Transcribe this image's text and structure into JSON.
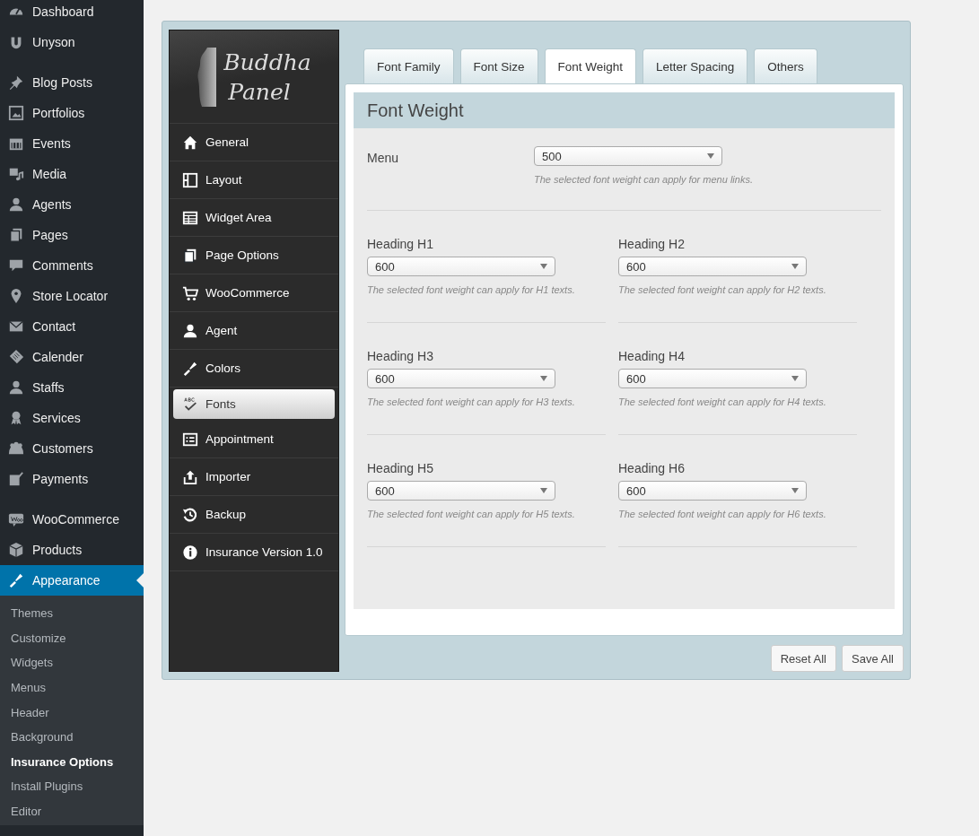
{
  "admin_menu": {
    "groups": [
      [
        {
          "label": "Dashboard",
          "selected": false
        },
        {
          "label": "Unyson",
          "selected": false
        }
      ],
      [
        {
          "label": "Blog Posts",
          "selected": false
        },
        {
          "label": "Portfolios",
          "selected": false
        },
        {
          "label": "Events",
          "selected": false
        },
        {
          "label": "Media",
          "selected": false
        },
        {
          "label": "Agents",
          "selected": false
        },
        {
          "label": "Pages",
          "selected": false
        },
        {
          "label": "Comments",
          "selected": false
        },
        {
          "label": "Store Locator",
          "selected": false
        },
        {
          "label": "Contact",
          "selected": false
        },
        {
          "label": "Calender",
          "selected": false
        },
        {
          "label": "Staffs",
          "selected": false
        },
        {
          "label": "Services",
          "selected": false
        },
        {
          "label": "Customers",
          "selected": false
        },
        {
          "label": "Payments",
          "selected": false
        }
      ],
      [
        {
          "label": "WooCommerce",
          "selected": false
        },
        {
          "label": "Products",
          "selected": false
        },
        {
          "label": "Appearance",
          "selected": true
        }
      ]
    ],
    "submenu": [
      {
        "label": "Themes",
        "selected": false
      },
      {
        "label": "Customize",
        "selected": false
      },
      {
        "label": "Widgets",
        "selected": false
      },
      {
        "label": "Menus",
        "selected": false
      },
      {
        "label": "Header",
        "selected": false
      },
      {
        "label": "Background",
        "selected": false
      },
      {
        "label": "Insurance Options",
        "selected": true
      },
      {
        "label": "Install Plugins",
        "selected": false
      },
      {
        "label": "Editor",
        "selected": false
      }
    ]
  },
  "panel": {
    "logo": {
      "line_1": "Buddha",
      "line_2": "Panel"
    },
    "nav": [
      {
        "label": "General",
        "selected": false
      },
      {
        "label": "Layout",
        "selected": false
      },
      {
        "label": "Widget Area",
        "selected": false
      },
      {
        "label": "Page Options",
        "selected": false
      },
      {
        "label": "WooCommerce",
        "selected": false
      },
      {
        "label": "Agent",
        "selected": false
      },
      {
        "label": "Colors",
        "selected": false
      },
      {
        "label": "Fonts",
        "selected": true
      },
      {
        "label": "Appointment",
        "selected": false
      },
      {
        "label": "Importer",
        "selected": false
      },
      {
        "label": "Backup",
        "selected": false
      },
      {
        "label": "Insurance Version 1.0",
        "selected": false
      }
    ],
    "tabs": [
      {
        "label": "Font Family",
        "selected": false
      },
      {
        "label": "Font Size",
        "selected": false
      },
      {
        "label": "Font Weight",
        "selected": true
      },
      {
        "label": "Letter Spacing",
        "selected": false
      },
      {
        "label": "Others",
        "selected": false
      }
    ],
    "section_title": "Font Weight",
    "menu_field": {
      "label": "Menu",
      "value": "500",
      "hint": "The selected font weight can apply for menu links."
    },
    "heading_fields": [
      {
        "label": "Heading H1",
        "value": "600",
        "hint": "The selected font weight can apply for H1 texts."
      },
      {
        "label": "Heading H2",
        "value": "600",
        "hint": "The selected font weight can apply for H2 texts."
      },
      {
        "label": "Heading H3",
        "value": "600",
        "hint": "The selected font weight can apply for H3 texts."
      },
      {
        "label": "Heading H4",
        "value": "600",
        "hint": "The selected font weight can apply for H4 texts."
      },
      {
        "label": "Heading H5",
        "value": "600",
        "hint": "The selected font weight can apply for H5 texts."
      },
      {
        "label": "Heading H6",
        "value": "600",
        "hint": "The selected font weight can apply for H6 texts."
      }
    ],
    "buttons": [
      "Reset All",
      "Save All"
    ]
  }
}
